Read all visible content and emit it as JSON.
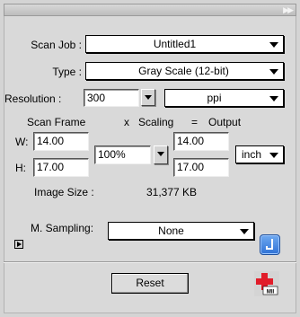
{
  "panel": {
    "collapse_icon": "double-chevron-right-icon"
  },
  "scan_job": {
    "label": "Scan Job :",
    "value": "Untitled1"
  },
  "type": {
    "label": "Type :",
    "value": "Gray Scale (12-bit)"
  },
  "resolution": {
    "label": "Resolution :",
    "value": "300",
    "unit": "ppi"
  },
  "scan_frame": {
    "header_frame": "Scan Frame",
    "header_x": "x",
    "header_scaling": "Scaling",
    "header_eq": "=",
    "header_output": "Output",
    "w_label": "W:",
    "h_label": "H:",
    "w_value": "14.00",
    "h_value": "17.00",
    "scaling": "100%",
    "out_w": "14.00",
    "out_h": "17.00",
    "unit": "inch"
  },
  "image_size": {
    "label": "Image Size :",
    "value": "31,377 KB"
  },
  "sampling": {
    "label": "M. Sampling:",
    "value": "None"
  },
  "reset_label": "Reset",
  "logo_text": "MII"
}
